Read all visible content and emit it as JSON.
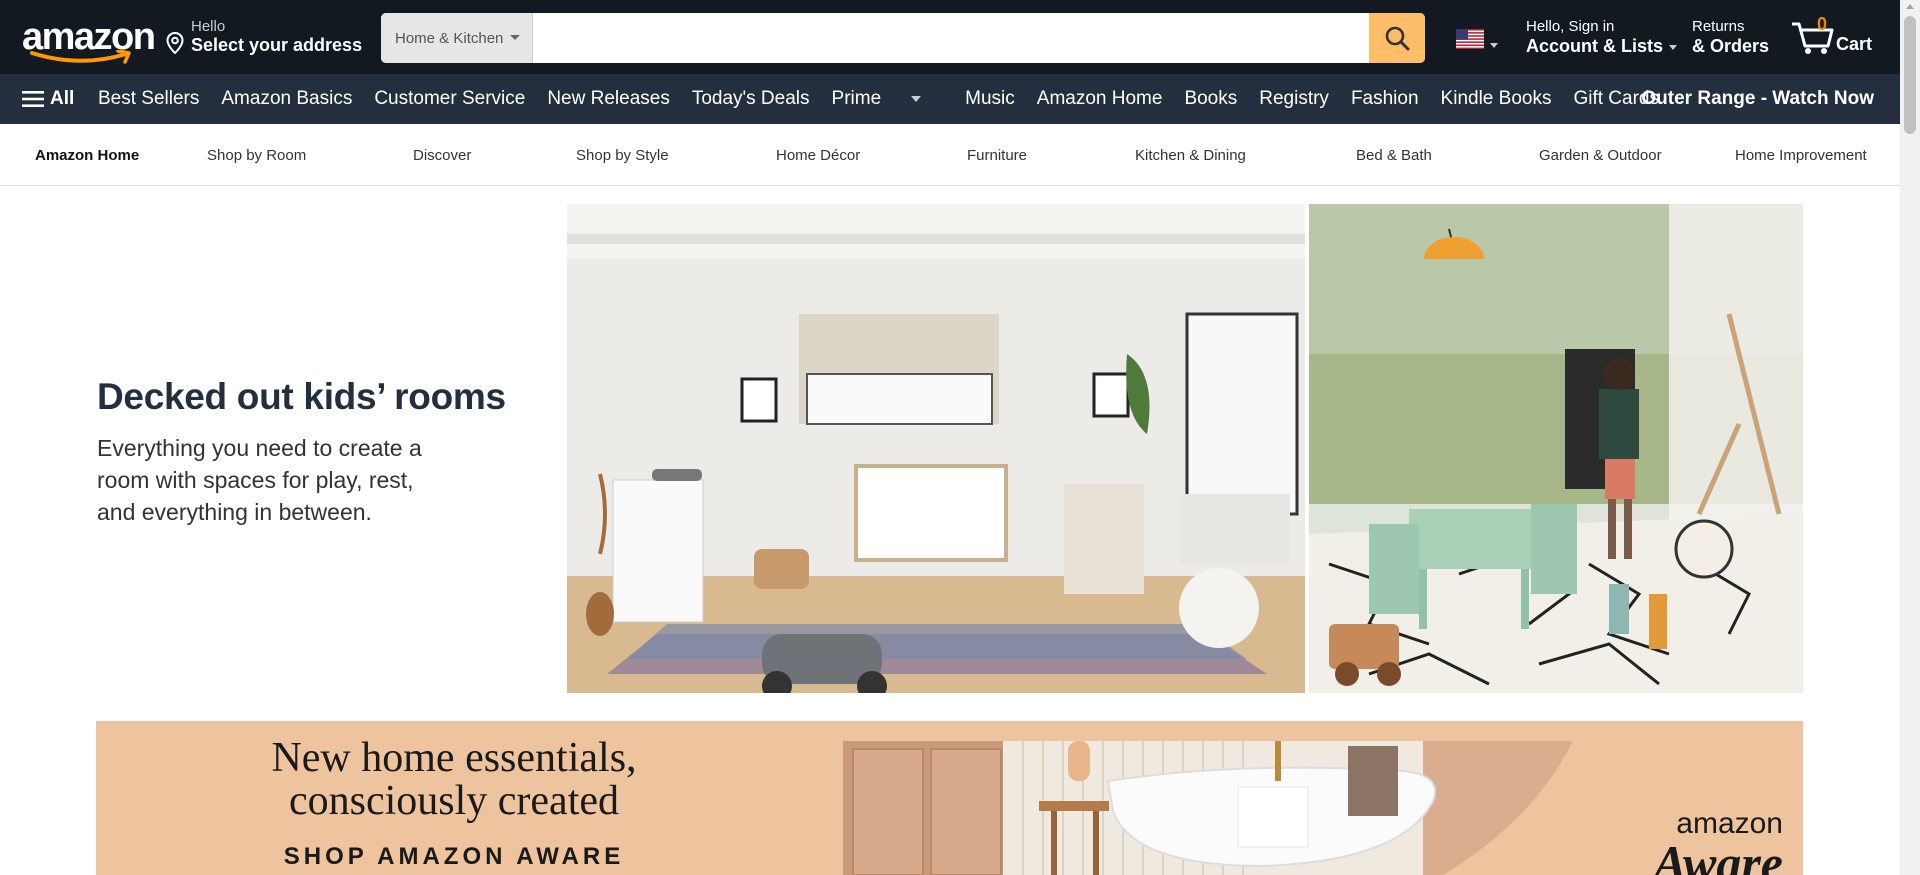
{
  "header": {
    "logo_text": "amazon",
    "address": {
      "greeting": "Hello",
      "label": "Select your address"
    },
    "search": {
      "category": "Home & Kitchen",
      "placeholder": "",
      "value": ""
    },
    "account": {
      "greeting": "Hello, Sign in",
      "label": "Account & Lists"
    },
    "orders": {
      "line1": "Returns",
      "line2": "& Orders"
    },
    "cart": {
      "count": "0",
      "label": "Cart"
    },
    "colors": {
      "bg": "#131921",
      "search_button": "#febd69",
      "cart_count": "#f08804"
    }
  },
  "subnav": {
    "all_label": "All",
    "links": [
      "Best Sellers",
      "Amazon Basics",
      "Customer Service",
      "New Releases",
      "Today's Deals",
      "Prime",
      "Music",
      "Amazon Home",
      "Books",
      "Registry",
      "Fashion",
      "Kindle Books",
      "Gift Cards"
    ],
    "promo": "Outer Range - Watch Now",
    "color": "#232f3e"
  },
  "store_nav": {
    "items": [
      "Amazon Home",
      "Shop by Room",
      "Discover",
      "Shop by Style",
      "Home Décor",
      "Furniture",
      "Kitchen & Dining",
      "Bed & Bath",
      "Garden & Outdoor",
      "Home Improvement"
    ]
  },
  "hero": {
    "title": "Decked out kids’ rooms",
    "description": "Everything you need to create a room with spaces for play, rest, and everything in between."
  },
  "banner": {
    "headline_line1": "New home essentials,",
    "headline_line2": "consciously created",
    "cta": "SHOP AMAZON AWARE",
    "logo_line1": "amazon",
    "logo_line2": "Aware",
    "color": "#eec49f"
  }
}
